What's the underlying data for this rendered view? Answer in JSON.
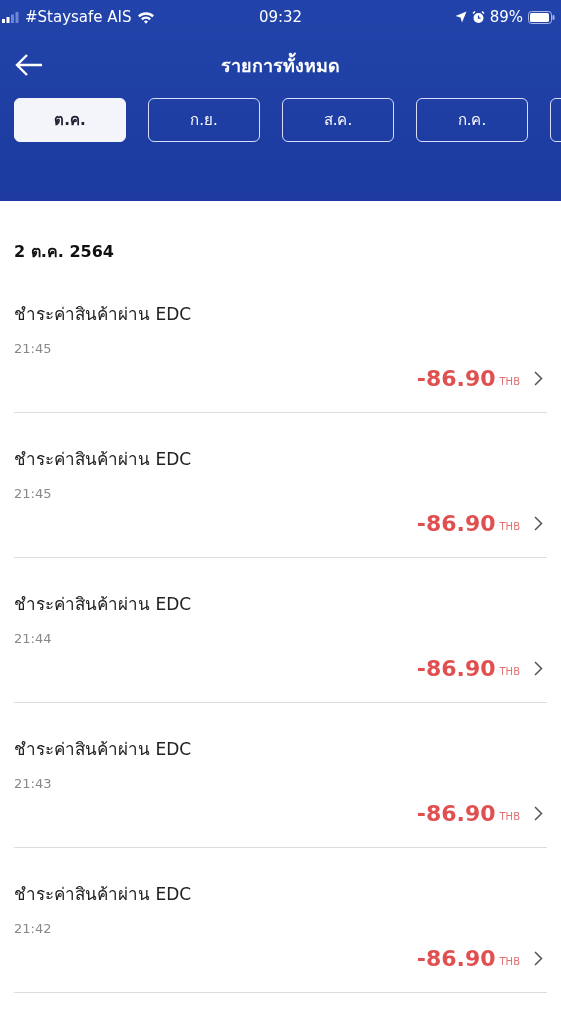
{
  "status_bar": {
    "carrier": "#Staysafe AIS",
    "time": "09:32",
    "battery": "89%"
  },
  "header": {
    "title": "รายการทั้งหมด"
  },
  "tabs": [
    {
      "label": "ต.ค.",
      "selected": true
    },
    {
      "label": "ก.ย.",
      "selected": false
    },
    {
      "label": "ส.ค.",
      "selected": false
    },
    {
      "label": "ก.ค.",
      "selected": false
    }
  ],
  "date_heading": "2 ต.ค. 2564",
  "transactions": [
    {
      "title": "ชำระค่าสินค้าผ่าน EDC",
      "time": "21:45",
      "amount": "-86.90",
      "currency": "THB"
    },
    {
      "title": "ชำระค่าสินค้าผ่าน EDC",
      "time": "21:45",
      "amount": "-86.90",
      "currency": "THB"
    },
    {
      "title": "ชำระค่าสินค้าผ่าน EDC",
      "time": "21:44",
      "amount": "-86.90",
      "currency": "THB"
    },
    {
      "title": "ชำระค่าสินค้าผ่าน EDC",
      "time": "21:43",
      "amount": "-86.90",
      "currency": "THB"
    },
    {
      "title": "ชำระค่าสินค้าผ่าน EDC",
      "time": "21:42",
      "amount": "-86.90",
      "currency": "THB"
    }
  ]
}
